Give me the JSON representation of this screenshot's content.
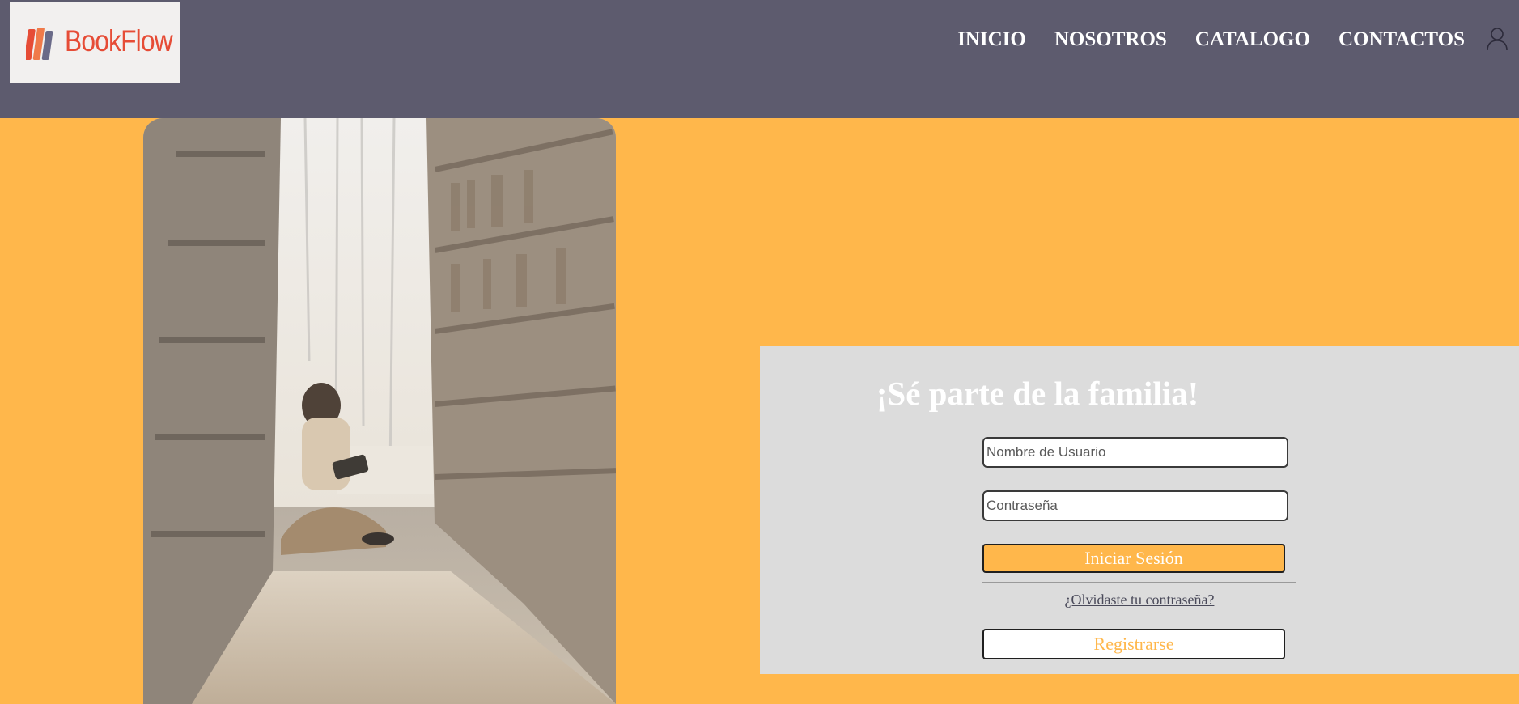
{
  "brand": {
    "name": "BookFlow"
  },
  "nav": {
    "items": [
      {
        "label": "INICIO"
      },
      {
        "label": "NOSOTROS"
      },
      {
        "label": "CATALOGO"
      },
      {
        "label": "CONTACTOS"
      }
    ]
  },
  "colors": {
    "header_bg": "#5d5b6e",
    "page_bg": "#ffb74b",
    "card_bg": "#dcdcdc",
    "logo_red": "#e64c36",
    "accent": "#ffb74b"
  },
  "icons": {
    "user": "user-icon",
    "logo": "books-logo-icon"
  },
  "login": {
    "title": "¡Sé parte de la familia!",
    "username_placeholder": "Nombre de Usuario",
    "password_placeholder": "Contraseña",
    "login_button": "Iniciar Sesión",
    "forgot_link": "¿Olvidaste tu contraseña?",
    "register_button": "Registrarse"
  }
}
